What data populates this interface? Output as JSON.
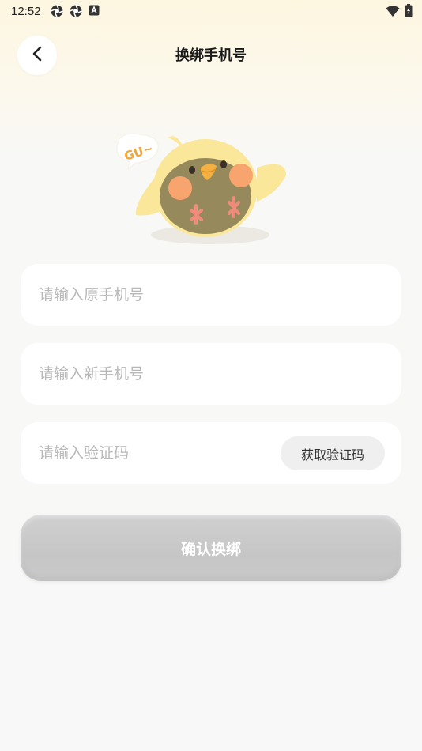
{
  "status_bar": {
    "time": "12:52",
    "icons_left": [
      "aperture-icon",
      "aperture-icon",
      "a-notification-icon"
    ],
    "icons_right": [
      "wifi-icon",
      "battery-charging-icon"
    ]
  },
  "header": {
    "title": "换绑手机号",
    "back_icon": "chevron-left-icon"
  },
  "mascot": {
    "bubble_text": "GU~"
  },
  "form": {
    "old_phone_placeholder": "请输入原手机号",
    "new_phone_placeholder": "请输入新手机号",
    "code_placeholder": "请输入验证码",
    "get_code_label": "获取验证码"
  },
  "confirm_label": "确认换绑",
  "colors": {
    "background": "#f8f8f8",
    "header_tint": "#fdf6e0",
    "field_bg": "#ffffff",
    "placeholder": "#b8b8b8",
    "button_disabled": "#cbcbcb",
    "chick_yellow": "#fbe79a",
    "chick_cheek": "#f7a46f"
  }
}
